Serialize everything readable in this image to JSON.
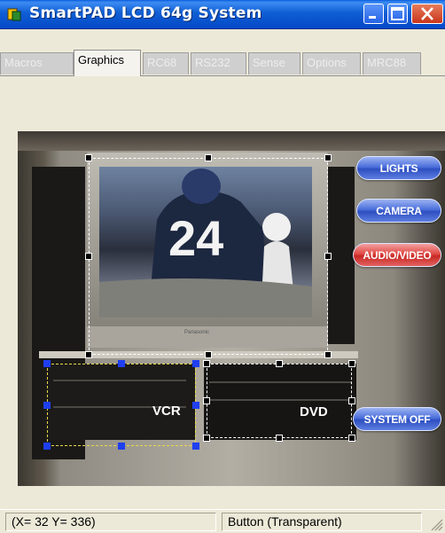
{
  "window": {
    "title": "SmartPAD LCD 64g System"
  },
  "tabs": [
    {
      "label": "Macros",
      "active": false
    },
    {
      "label": "Graphics",
      "active": true
    },
    {
      "label": "RC68",
      "active": false
    },
    {
      "label": "RS232",
      "active": false
    },
    {
      "label": "Sense",
      "active": false
    },
    {
      "label": "Options",
      "active": false
    },
    {
      "label": "MRC88",
      "active": false
    }
  ],
  "canvas": {
    "tv": {
      "jersey_number": "24",
      "brand_mark": "Panasonic"
    },
    "vcr_label": "VCR",
    "dvd_label": "DVD",
    "buttons": {
      "lights": "LIGHTS",
      "camera": "CAMERA",
      "audio_video": "AUDIO/VIDEO",
      "system_off": "SYSTEM OFF"
    }
  },
  "statusbar": {
    "coords": "(X= 32 Y= 336)",
    "object_type": "Button (Transparent)"
  },
  "colors": {
    "titlebar": "#0a5ede",
    "selection_handle": "#000000",
    "active_handle": "#1f3ff0",
    "pill_blue": "#4b6fdb",
    "pill_red": "#e04a45"
  }
}
